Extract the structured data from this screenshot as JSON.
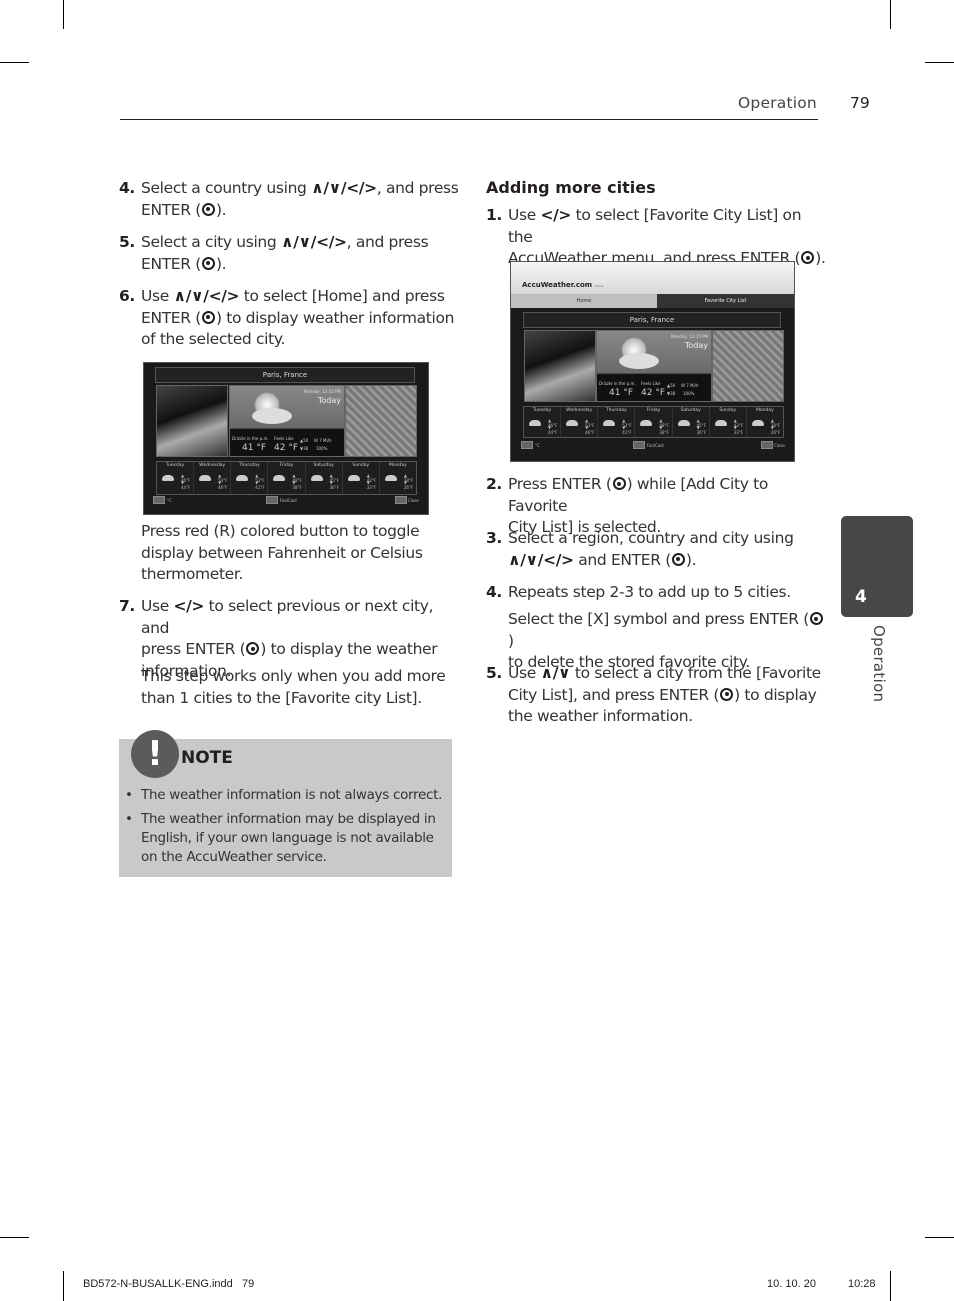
{
  "header": {
    "section": "Operation",
    "page_number": "79"
  },
  "left_column": {
    "steps": [
      {
        "num": "4.",
        "pre": "Select a country using ",
        "arrows": "∧/∨/</>",
        "post": ", and press",
        "line2_pre": "ENTER (",
        "line2_post": ")."
      },
      {
        "num": "5.",
        "pre": "Select a city using ",
        "arrows": "∧/∨/</>",
        "post": ", and press",
        "line2_pre": "ENTER (",
        "line2_post": ")."
      },
      {
        "num": "6.",
        "pre": "Use ",
        "arrows": "∧/∨/</>",
        "post": " to select [Home] and press",
        "line2_pre": "ENTER (",
        "line2_post": ") to display weather information",
        "line3": "of the selected city."
      }
    ],
    "toggle_note": [
      "Press red (R) colored button to toggle",
      "display between Fahrenheit or Celsius",
      "thermometer."
    ],
    "step7": {
      "num": "7.",
      "pre": "Use ",
      "arrows": "</>",
      "post": " to select previous or next city, and",
      "line2_pre": "press ENTER (",
      "line2_post": ") to display the weather",
      "line3": "information."
    },
    "step7_note": [
      "This step works only when you add more",
      "than 1 cities to the [Favorite city List]."
    ]
  },
  "weather_screen": {
    "city": "Paris, France",
    "date": "Monday, 12:15 PM",
    "today_label": "Today",
    "condition": "Drizzle in the p.m.",
    "temp": "41 °F",
    "feels_like_label": "Feels Like",
    "feels_like": "42 °F",
    "hi": "▲50",
    "lo": "▼38",
    "wind": "W 7 Mi/h",
    "humidity": "100%",
    "forecast": [
      {
        "day": "Tuesday",
        "hi": "▲ 46°F",
        "lo": "▼ 44°F"
      },
      {
        "day": "Wednesday",
        "hi": "▲ 53°F",
        "lo": "▼ 46°F"
      },
      {
        "day": "Thursday",
        "hi": "▲ 53°F",
        "lo": "▼ 41°F"
      },
      {
        "day": "Friday",
        "hi": "▲ 48°F",
        "lo": "▼ 38°F"
      },
      {
        "day": "Saturday",
        "hi": "▲ 45°F",
        "lo": "▼ 36°F"
      },
      {
        "day": "Sunday",
        "hi": "▲ 43°F",
        "lo": "▼ 33°F"
      },
      {
        "day": "Monday",
        "hi": "▲ 38°F",
        "lo": "▼ 26°F"
      }
    ],
    "footer_left": "°C",
    "footer_mid": "FastCast",
    "footer_right": "Close"
  },
  "accuweather_screen": {
    "logo": "AccuWeather.com",
    "logo_sub": "Home",
    "tab_home": "Home",
    "tab_favorites": "Favorite City List"
  },
  "right_column": {
    "title": "Adding more cities",
    "step1": {
      "num": "1.",
      "pre": "Use ",
      "arrows": "</>",
      "post": " to select [Favorite City List] on the",
      "line2_pre": "AccuWeather menu, and press ENTER (",
      "line2_post": ")."
    },
    "step2": {
      "num": "2.",
      "pre": "Press ENTER (",
      "post": ") while [Add City to Favorite",
      "line2": "City List] is selected."
    },
    "step3": {
      "num": "3.",
      "line1": "Select a region, country and city using",
      "arrows": "∧/∨/</>",
      "line2_post": " and ENTER (",
      "line2_end": ")."
    },
    "step4": {
      "num": "4.",
      "line1": "Repeats step 2-3 to add up to 5 cities.",
      "sub_pre": "Select the [X] symbol and press ENTER (",
      "sub_post": ")",
      "sub_line2": "to delete the stored favorite city."
    },
    "step5": {
      "num": "5.",
      "pre": "Use ",
      "arrows": "∧/∨",
      "post": " to select a city from the [Favorite",
      "line2_pre": "City List], and press ENTER (",
      "line2_post": ") to display",
      "line3": "the weather information."
    }
  },
  "note": {
    "title": "NOTE",
    "items": [
      "The weather information is not always correct.",
      "The weather information may be displayed in English, if your own language is not available on the AccuWeather service."
    ]
  },
  "side_tab": {
    "number": "4",
    "label": "Operation"
  },
  "footer": {
    "file": "BD572-N-BUSALLK-ENG.indd   79",
    "date": "10. 10. 20",
    "time": "10:28"
  }
}
